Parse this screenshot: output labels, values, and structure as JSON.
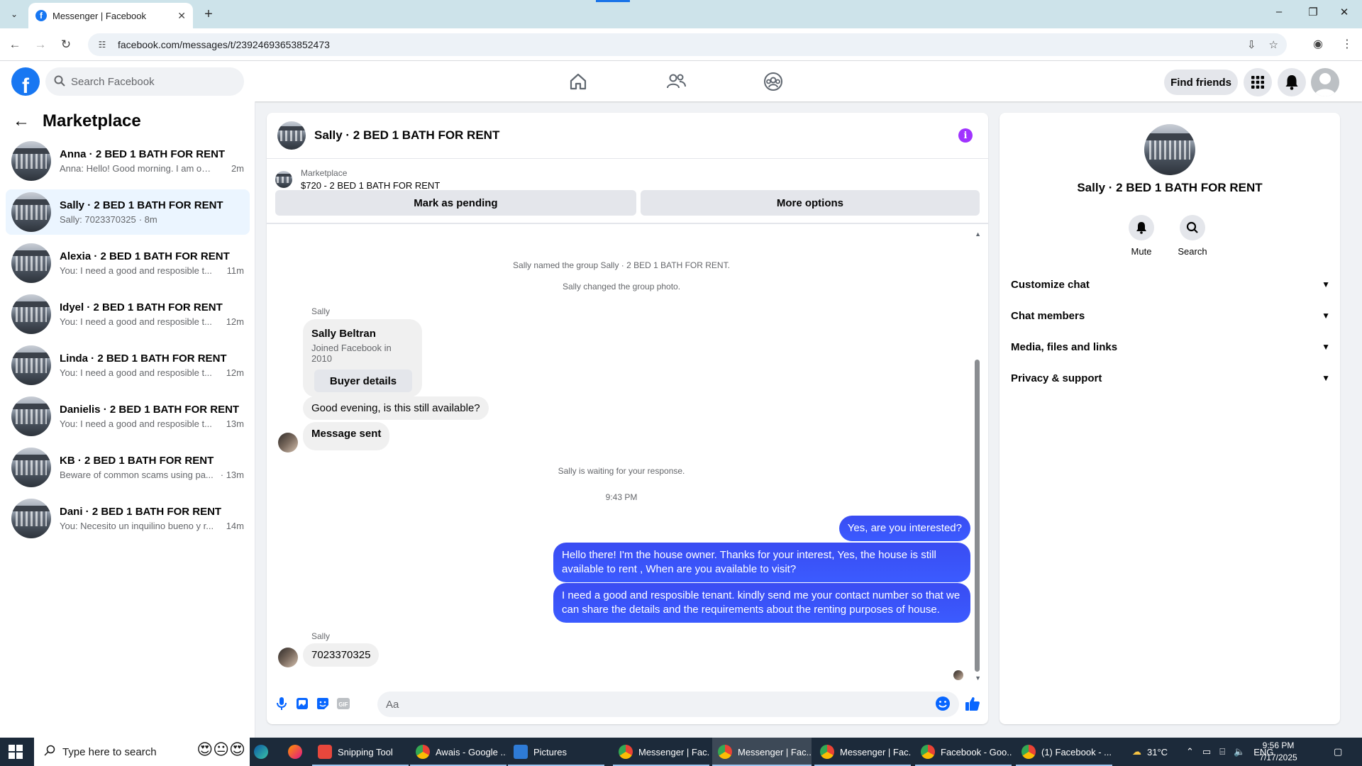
{
  "browser": {
    "tab_title": "Messenger | Facebook",
    "url": "facebook.com/messages/t/23924693653852473"
  },
  "fb": {
    "search_placeholder": "Search Facebook",
    "find_friends": "Find friends",
    "brand_color": "#1877f2"
  },
  "left": {
    "title": "Marketplace",
    "conversations": [
      {
        "title": "Anna · 2 BED 1 BATH FOR RENT",
        "preview": "Anna: Hello! Good morning. I am out ...",
        "time": "2m"
      },
      {
        "title": "Sally · 2 BED 1 BATH FOR RENT",
        "preview": "Sally: 7023370325",
        "time": "· 8m"
      },
      {
        "title": "Alexia · 2 BED 1 BATH FOR RENT",
        "preview": "You: I need a good and resposible t...",
        "time": "11m"
      },
      {
        "title": "Idyel · 2 BED 1 BATH FOR RENT",
        "preview": "You: I need a good and resposible t...",
        "time": "12m"
      },
      {
        "title": "Linda · 2 BED 1 BATH FOR RENT",
        "preview": "You: I need a good and resposible t...",
        "time": "12m"
      },
      {
        "title": "Danielis · 2 BED 1 BATH FOR RENT",
        "preview": "You: I need a good and resposible t...",
        "time": "13m"
      },
      {
        "title": "KB · 2 BED 1 BATH FOR RENT",
        "preview": "Beware of common scams using pa...",
        "time": "· 13m"
      },
      {
        "title": "Dani · 2 BED 1 BATH FOR RENT",
        "preview": "You: Necesito un inquilino bueno y r...",
        "time": "14m"
      }
    ]
  },
  "chat": {
    "title": "Sally · 2 BED 1 BATH FOR RENT",
    "listing_label": "Marketplace",
    "listing_price": "$720 - 2 BED 1 BATH FOR RENT",
    "mark_pending": "Mark as pending",
    "more_options": "More options",
    "sys_named": "Sally named the group Sally · 2 BED 1 BATH FOR RENT.",
    "sys_photo": "Sally changed the group photo.",
    "sender_1": "Sally",
    "buyer_name": "Sally Beltran",
    "buyer_joined": "Joined Facebook in 2010",
    "buyer_details": "Buyer details",
    "msg_in_1": "Good evening, is this still available?",
    "msg_in_2": "Message sent",
    "sys_waiting": "Sally is waiting for your response.",
    "timestamp": "9:43 PM",
    "msg_out_1": "Yes, are you interested?",
    "msg_out_2": "Hello there! I'm the house owner. Thanks for your interest, Yes, the house is still available to rent , When are you available to visit?",
    "msg_out_3": "I need a good and resposible tenant.  kindly send me your contact number so that we can share the details and the requirements about the renting purposes of house.",
    "sender_2": "Sally",
    "msg_in_3": "7023370325",
    "input_placeholder": "Aa",
    "outgoing_color": "#3b4ef5"
  },
  "right": {
    "title": "Sally · 2 BED 1 BATH FOR RENT",
    "mute": "Mute",
    "search": "Search",
    "sections": [
      "Customize chat",
      "Chat members",
      "Media, files and links",
      "Privacy & support"
    ]
  },
  "taskbar": {
    "search_placeholder": "Type here to search",
    "apps": [
      {
        "label": "Snipping Tool"
      },
      {
        "label": "Awais - Google ..."
      },
      {
        "label": "Pictures"
      },
      {
        "label": "Messenger | Fac..."
      },
      {
        "label": "Messenger | Fac..."
      },
      {
        "label": "Messenger | Fac..."
      },
      {
        "label": "Facebook - Goo..."
      },
      {
        "label": "(1) Facebook - ..."
      }
    ],
    "weather": "31°C",
    "lang": "ENG",
    "time": "9:56 PM",
    "date": "7/17/2025"
  }
}
